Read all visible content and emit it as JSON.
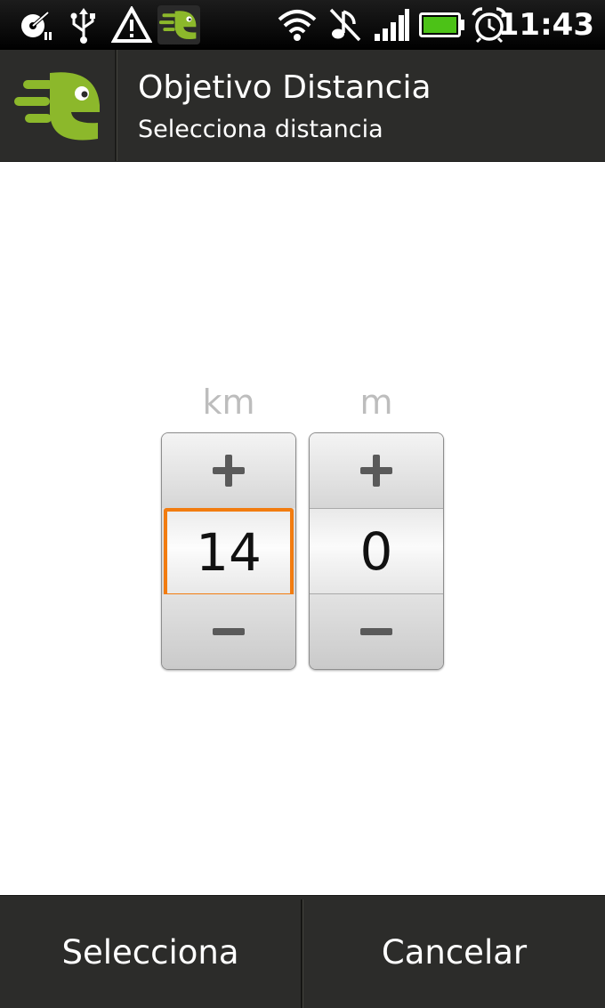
{
  "status_bar": {
    "time": "11:43",
    "icons": [
      "music-player-icon",
      "usb-icon",
      "warning-icon",
      "endomondo-app-icon",
      "wifi-icon",
      "sound-muted-icon",
      "signal-icon",
      "battery-icon",
      "alarm-icon"
    ]
  },
  "title_bar": {
    "title": "Objetivo Distancia",
    "subtitle": "Selecciona distancia"
  },
  "picker": {
    "km_label": "km",
    "m_label": "m",
    "km_value": "14",
    "m_value": "0"
  },
  "buttons": {
    "select": "Selecciona",
    "cancel": "Cancelar"
  },
  "colors": {
    "accent_focus": "#f27c10",
    "brand_green": "#8cb82b",
    "bar_background": "#2c2c2a"
  }
}
